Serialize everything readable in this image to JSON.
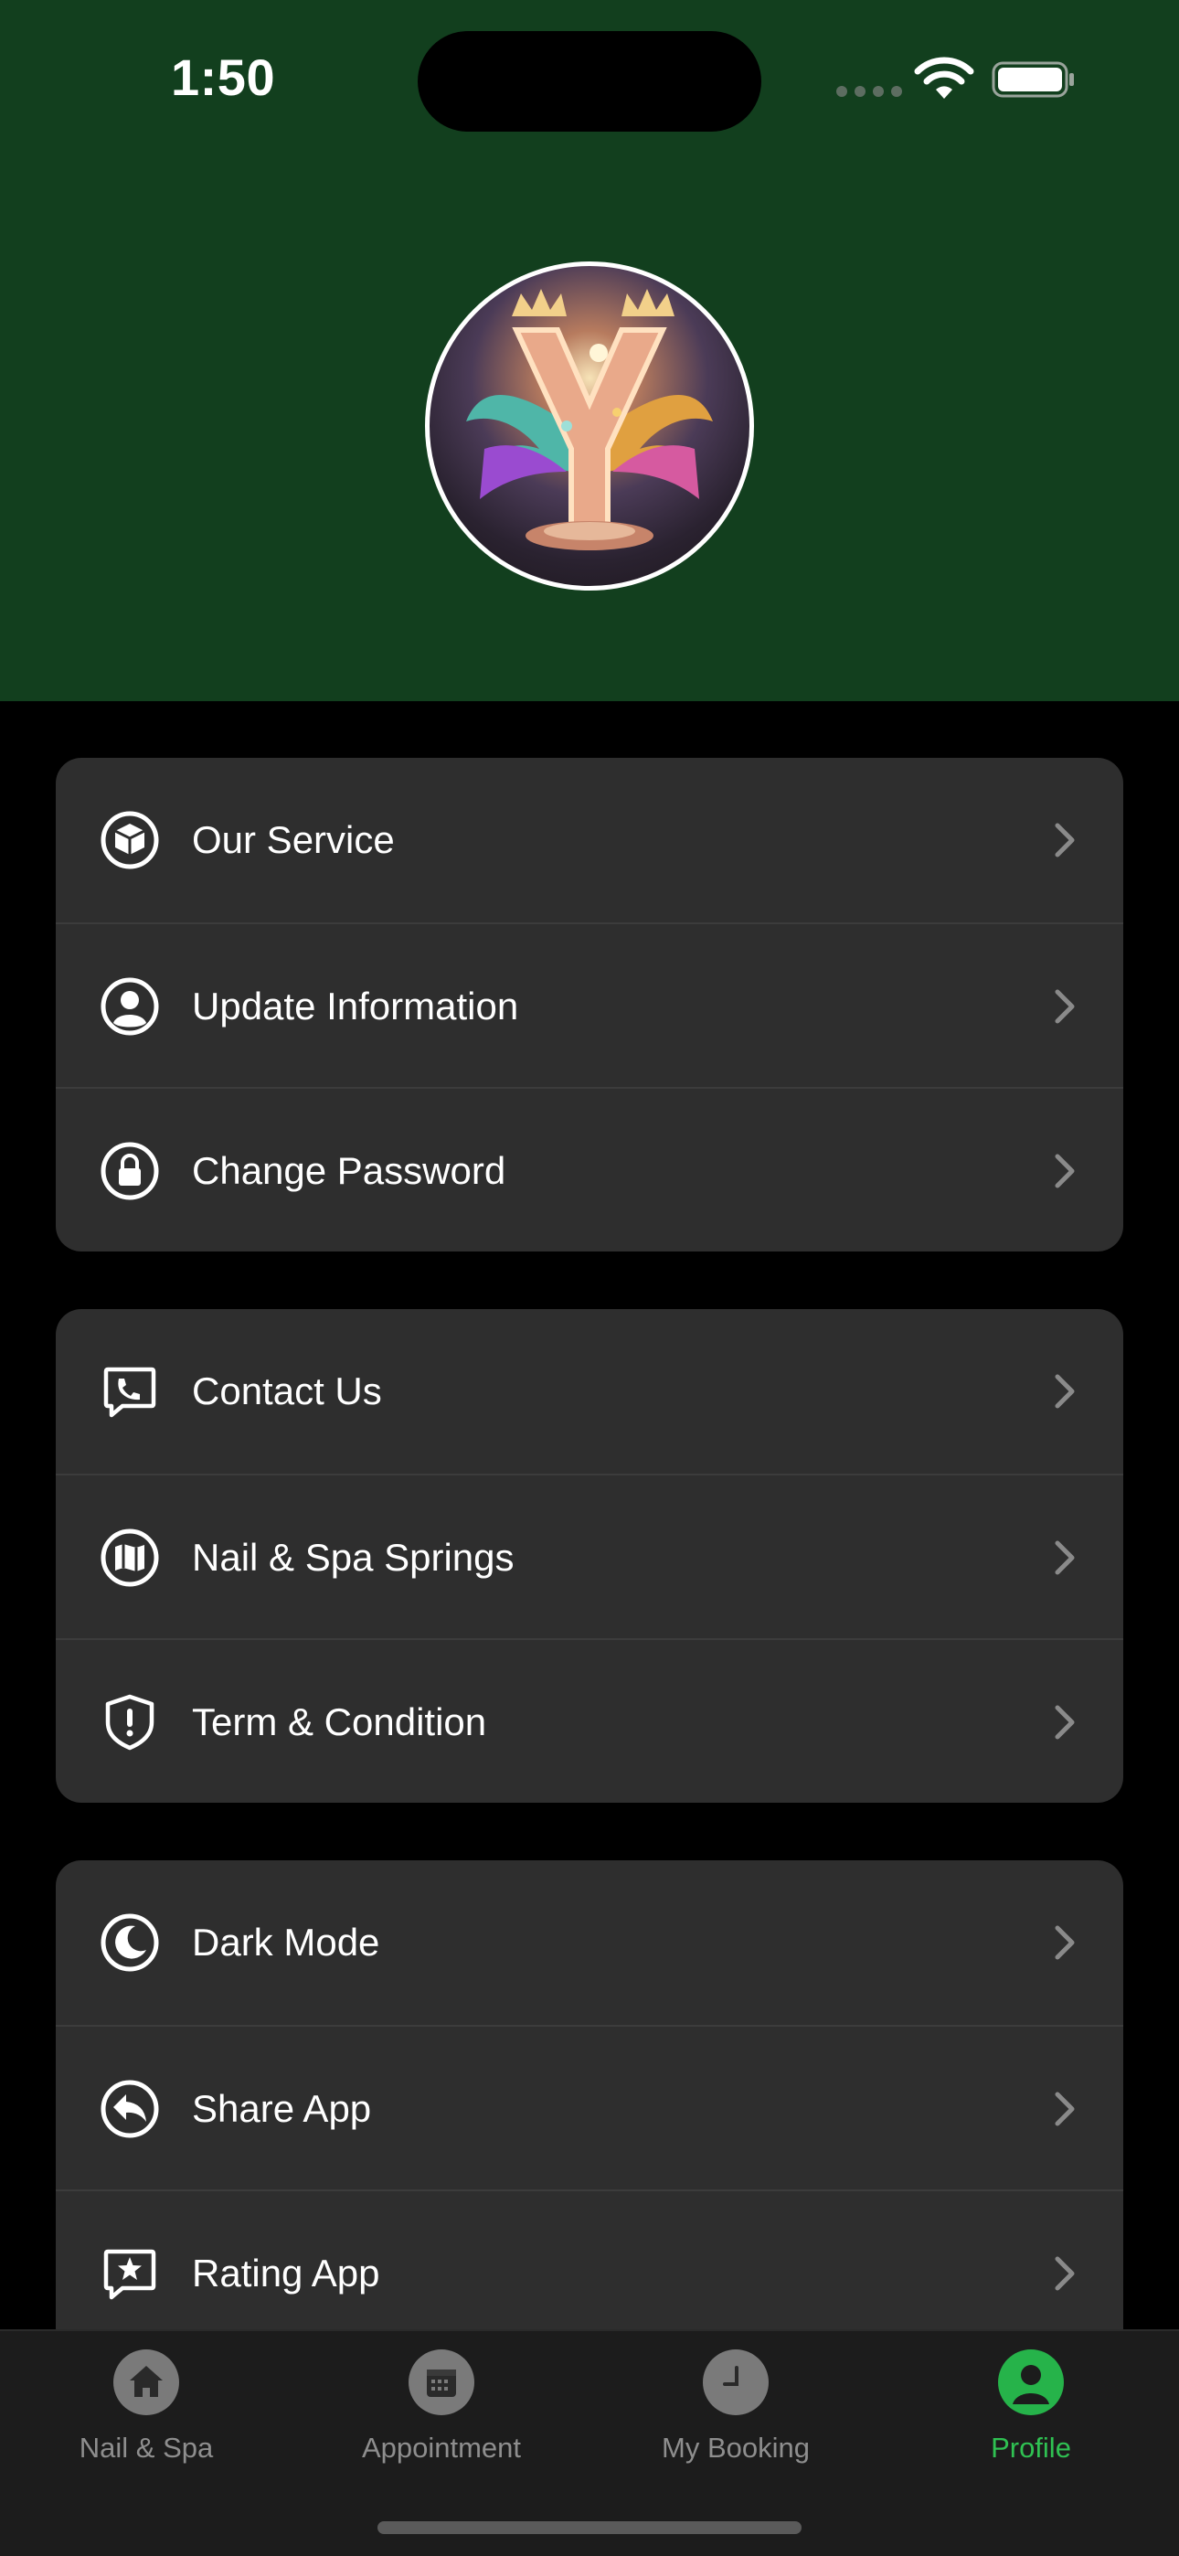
{
  "status_bar": {
    "time": "1:50"
  },
  "colors": {
    "header_bg": "#123f1e",
    "card_bg": "#2e2e2e",
    "accent": "#2fc152",
    "tab_inactive": "#8e8e8e"
  },
  "profile": {
    "avatar_icon": "logo-avatar"
  },
  "groups": [
    {
      "items": [
        {
          "label": "Our Service",
          "icon": "box-icon"
        },
        {
          "label": "Update Information",
          "icon": "person-circle-icon"
        },
        {
          "label": "Change Password",
          "icon": "lock-icon"
        }
      ]
    },
    {
      "items": [
        {
          "label": "Contact Us",
          "icon": "phone-bubble-icon"
        },
        {
          "label": "Nail & Spa Springs",
          "icon": "map-icon"
        },
        {
          "label": "Term & Condition",
          "icon": "shield-exclamation-icon"
        }
      ]
    },
    {
      "items": [
        {
          "label": "Dark Mode",
          "icon": "moon-icon"
        },
        {
          "label": "Share App",
          "icon": "share-arrow-icon"
        },
        {
          "label": "Rating App",
          "icon": "star-bubble-icon"
        }
      ]
    }
  ],
  "tabs": [
    {
      "label": "Nail & Spa",
      "icon": "home-icon",
      "active": false
    },
    {
      "label": "Appointment",
      "icon": "calendar-icon",
      "active": false
    },
    {
      "label": "My Booking",
      "icon": "clock-icon",
      "active": false
    },
    {
      "label": "Profile",
      "icon": "profile-icon",
      "active": true
    }
  ]
}
